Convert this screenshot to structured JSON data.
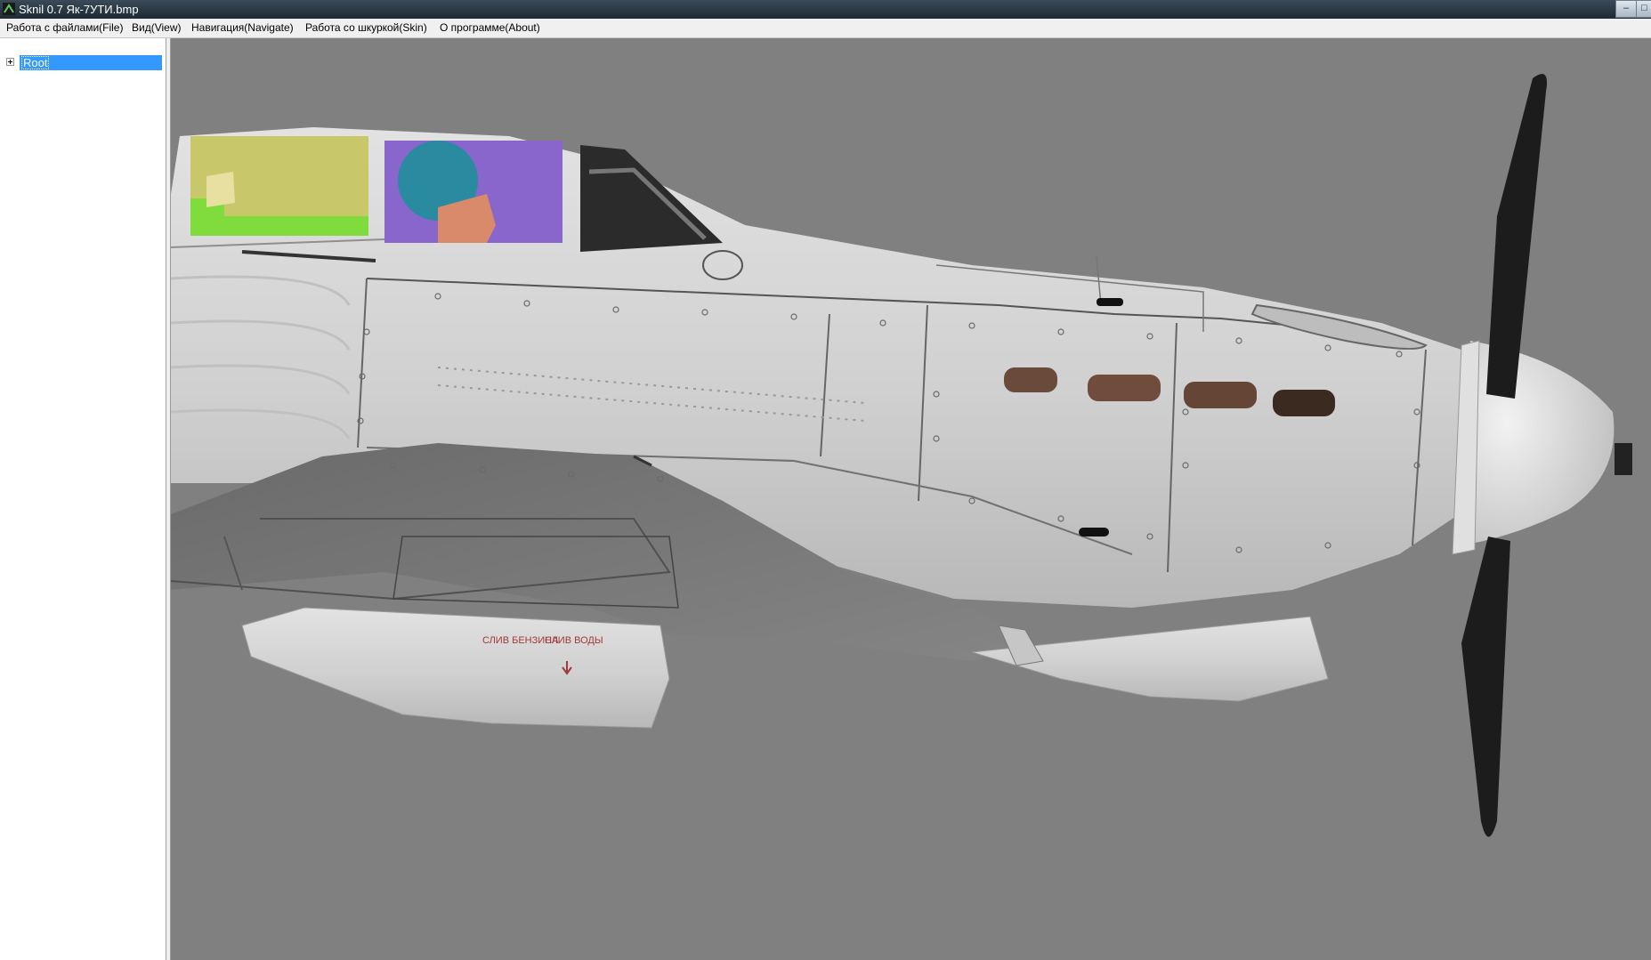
{
  "window": {
    "title": "Sknil 0.7   Як-7УТИ.bmp",
    "icon": "app-icon",
    "controls": {
      "minimize": "–",
      "maximize": "□"
    }
  },
  "menu": [
    {
      "label": "Работа с файлами(File)"
    },
    {
      "label": "Вид(View)"
    },
    {
      "label": "Навигация(Navigate)"
    },
    {
      "label": "Работа со шкуркой(Skin)"
    },
    {
      "label": "О программе(About)"
    }
  ],
  "tree": {
    "root": {
      "label": "Root",
      "expander_icon": "plus-box-icon",
      "selected": true
    }
  },
  "viewport": {
    "content": "3d-model-view",
    "background_color": "#808080",
    "markings": {
      "fuel_drain": "СЛИВ БЕНЗИНА",
      "water_drain": "СЛИВ ВОДЫ"
    },
    "colors": {
      "fuselage": "#d4d4d4",
      "wing": "#737373",
      "canopy_front": "#c8c86a",
      "canopy_rear": "#8866cc",
      "pilot_helmet": "#2a8aa0",
      "exhausts": "#6a4a3a",
      "propeller": "#1c1c1c"
    }
  }
}
